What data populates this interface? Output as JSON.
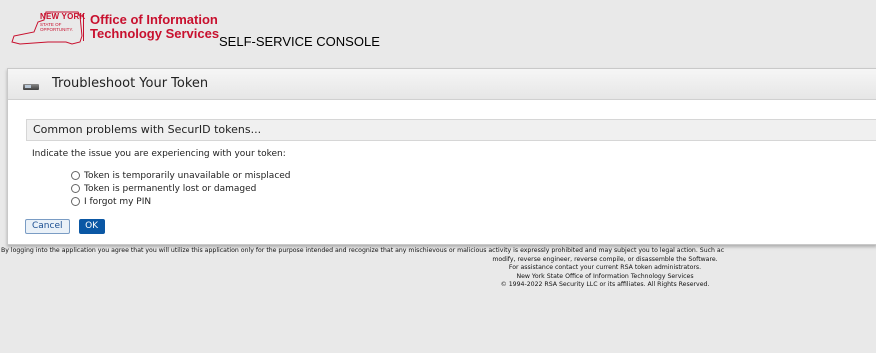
{
  "header": {
    "logo_ny": "NEW YORK",
    "logo_state": "STATE OF OPPORTUNITY.",
    "logo_office_line1": "Office of Information",
    "logo_office_line2": "Technology Services",
    "console_title": "SELF-SERVICE CONSOLE",
    "brand_color": "#c8102e"
  },
  "panel": {
    "title": "Troubleshoot Your Token",
    "icon": "token-icon",
    "section_title": "Common problems with SecurID tokens...",
    "instruction": "Indicate the issue you are experiencing with your token:",
    "options": [
      {
        "label": "Token is temporarily unavailable or misplaced",
        "selected": false
      },
      {
        "label": "Token is permanently lost or damaged",
        "selected": false
      },
      {
        "label": "I forgot my PIN",
        "selected": false
      }
    ],
    "cancel_label": "Cancel",
    "ok_label": "OK"
  },
  "footer": {
    "line1": "By logging into the application you agree that you will utilize this application only for the purpose intended and recognize that any mischievous or malicious activity is expressly prohibited and may subject you to legal action. Such ac",
    "line2": "modify, reverse engineer, reverse compile, or disassemble the Software.",
    "line3": "For assistance contact your current RSA token administrators.",
    "line4": "New York State Office of Information Technology Services",
    "line5": "© 1994-2022 RSA Security LLC or its affiliates. All Rights Reserved."
  }
}
